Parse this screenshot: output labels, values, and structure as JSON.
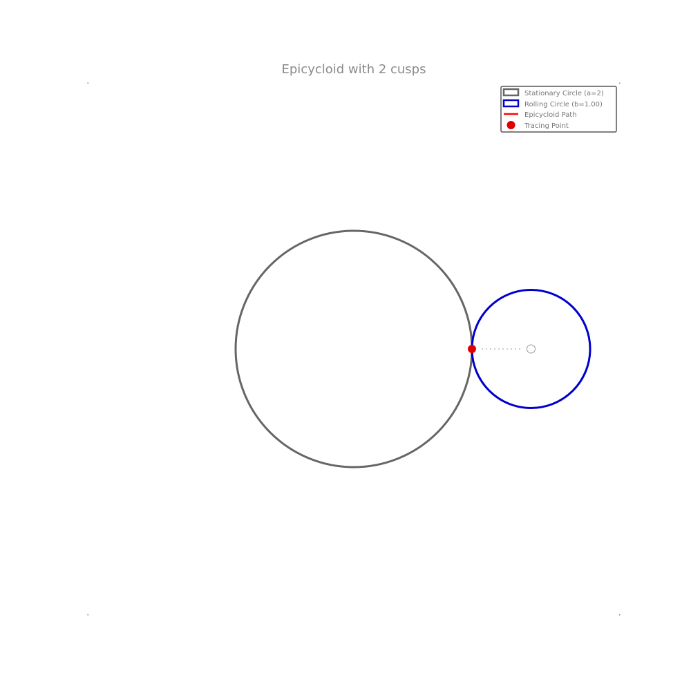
{
  "title": "Epicycloid with 2 cusps",
  "colors": {
    "stationary": "#666666",
    "rolling": "#0000cc",
    "path": "#ff0000",
    "tracing_point": "#e00000",
    "center_marker": "#999999",
    "corner_marks": "#999999",
    "legend_border": "#555555",
    "legend_text": "#777777"
  },
  "legend": {
    "placement": "top-right",
    "items": [
      {
        "label": "Stationary Circle (a=2)",
        "symbol": "rect",
        "color": "#666666"
      },
      {
        "label": "Rolling Circle (b=1.00)",
        "symbol": "rect",
        "color": "#0000cc"
      },
      {
        "label": "Epicycloid Path",
        "symbol": "line",
        "color": "#ff0000"
      },
      {
        "label": "Tracing Point",
        "symbol": "dot",
        "color": "#e00000"
      }
    ]
  },
  "diagram": {
    "stationary_radius": 2,
    "rolling_radius": 1,
    "rolling_center": [
      3,
      0
    ],
    "tracing_point": [
      2,
      0
    ],
    "axis_limits": [
      -4.5,
      4.5
    ]
  }
}
